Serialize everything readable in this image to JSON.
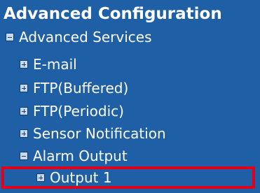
{
  "header": {
    "title": "Advanced Configuration"
  },
  "tree": {
    "advanced_services": {
      "label": "Advanced Services",
      "state": "expanded"
    },
    "items": [
      {
        "label": "E-mail",
        "state": "collapsed"
      },
      {
        "label": "FTP(Buffered)",
        "state": "collapsed"
      },
      {
        "label": "FTP(Periodic)",
        "state": "collapsed"
      },
      {
        "label": "Sensor Notification",
        "state": "collapsed"
      },
      {
        "label": "Alarm Output",
        "state": "expanded"
      }
    ],
    "alarm_output_children": [
      {
        "label": "Output 1",
        "state": "collapsed",
        "highlighted": true
      }
    ]
  },
  "colors": {
    "panel_background": "#1f5fa6",
    "text": "#ffffff",
    "highlight_border": "#e0001a"
  },
  "icons": {
    "expanded": "minus-box-icon",
    "collapsed": "plus-box-icon"
  }
}
